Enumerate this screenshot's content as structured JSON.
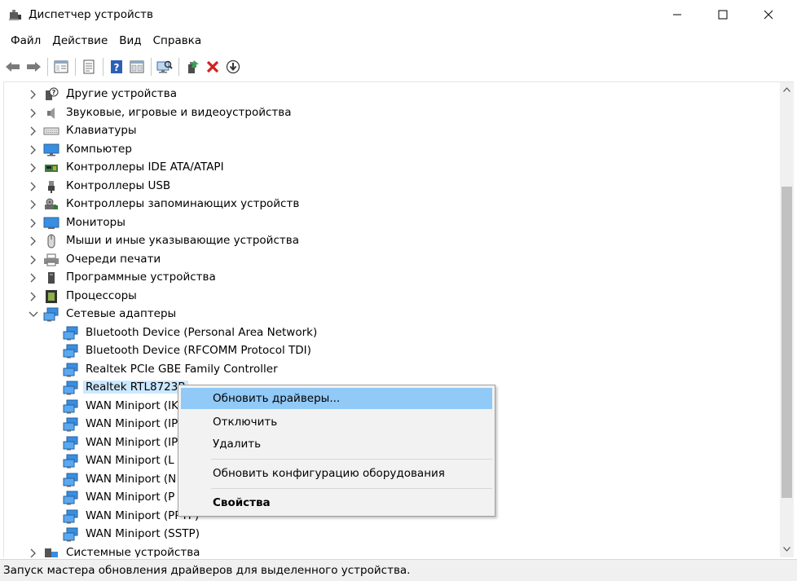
{
  "window": {
    "title": "Диспетчер устройств",
    "icon": "device-manager-icon"
  },
  "menu": [
    "Файл",
    "Действие",
    "Вид",
    "Справка"
  ],
  "toolbar": {
    "icons": [
      "back-arrow-icon",
      "forward-arrow-icon",
      "show-hide-tree-icon",
      "properties-icon",
      "help-icon",
      "view-icon",
      "scan-hardware-icon",
      "update-driver-icon",
      "uninstall-icon",
      "disable-icon"
    ]
  },
  "tree": {
    "categories": [
      {
        "label": "Другие устройства",
        "icon": "unknown-device-icon"
      },
      {
        "label": "Звуковые, игровые и видеоустройства",
        "icon": "speaker-icon"
      },
      {
        "label": "Клавиатуры",
        "icon": "keyboard-icon"
      },
      {
        "label": "Компьютер",
        "icon": "monitor-icon"
      },
      {
        "label": "Контроллеры IDE ATA/ATAPI",
        "icon": "ide-controller-icon"
      },
      {
        "label": "Контроллеры USB",
        "icon": "usb-icon"
      },
      {
        "label": "Контроллеры запоминающих устройств",
        "icon": "storage-controller-icon"
      },
      {
        "label": "Мониторы",
        "icon": "monitor-icon"
      },
      {
        "label": "Мыши и иные указывающие устройства",
        "icon": "mouse-icon"
      },
      {
        "label": "Очереди печати",
        "icon": "printer-icon"
      },
      {
        "label": "Программные устройства",
        "icon": "software-device-icon"
      },
      {
        "label": "Процессоры",
        "icon": "cpu-icon"
      },
      {
        "label": "Сетевые адаптеры",
        "icon": "network-adapter-icon"
      }
    ],
    "network_children": [
      "Bluetooth Device (Personal Area Network)",
      "Bluetooth Device (RFCOMM Protocol TDI)",
      "Realtek PCIe GBE Family Controller",
      "Realtek RTL8723B",
      "WAN Miniport (IK",
      "WAN Miniport (IP",
      "WAN Miniport (IP",
      "WAN Miniport (L",
      "WAN Miniport (N",
      "WAN Miniport (P",
      "WAN Miniport (PPTP)",
      "WAN Miniport (SSTP)"
    ],
    "last_category": {
      "label": "Системные устройства",
      "icon": "system-device-icon"
    }
  },
  "context_menu": {
    "update": "Обновить драйверы...",
    "disable": "Отключить",
    "uninstall": "Удалить",
    "scan": "Обновить конфигурацию оборудования",
    "properties": "Свойства"
  },
  "status": "Запуск мастера обновления драйверов для выделенного устройства."
}
